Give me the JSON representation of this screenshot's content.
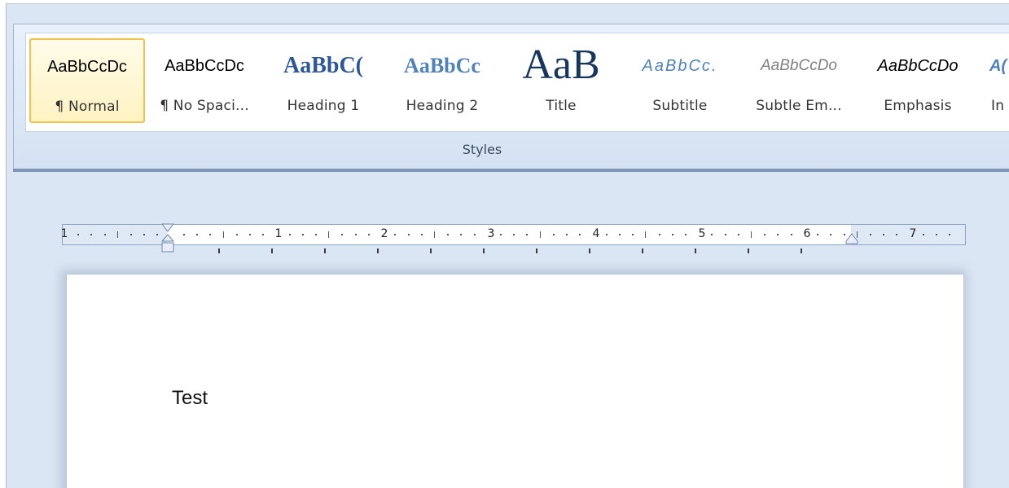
{
  "ribbon": {
    "styles_group_label": "Styles",
    "gallery": [
      {
        "sample": "AaBbCcDc",
        "label": "¶ Normal",
        "selected": true
      },
      {
        "sample": "AaBbCcDc",
        "label": "¶ No Spaci..."
      },
      {
        "sample": "AaBbC(",
        "label": "Heading 1"
      },
      {
        "sample": "AaBbCc",
        "label": "Heading 2"
      },
      {
        "sample": "AaB",
        "label": "Title"
      },
      {
        "sample": "AaBbCc.",
        "label": "Subtitle"
      },
      {
        "sample": "AaBbCcDo",
        "label": "Subtle Em..."
      },
      {
        "sample": "AaBbCcDo",
        "label": "Emphasis"
      },
      {
        "sample": "A(",
        "label": "In"
      }
    ]
  },
  "ruler": {
    "numbers": [
      "1",
      "1",
      "2",
      "3",
      "4",
      "5",
      "6",
      "7"
    ]
  },
  "document": {
    "text": "Test"
  },
  "colors": {
    "selected_border": "#f2c24f",
    "heading_blue": "#2b579a",
    "heading2_blue": "#4f81bd",
    "title_navy": "#17365d"
  }
}
